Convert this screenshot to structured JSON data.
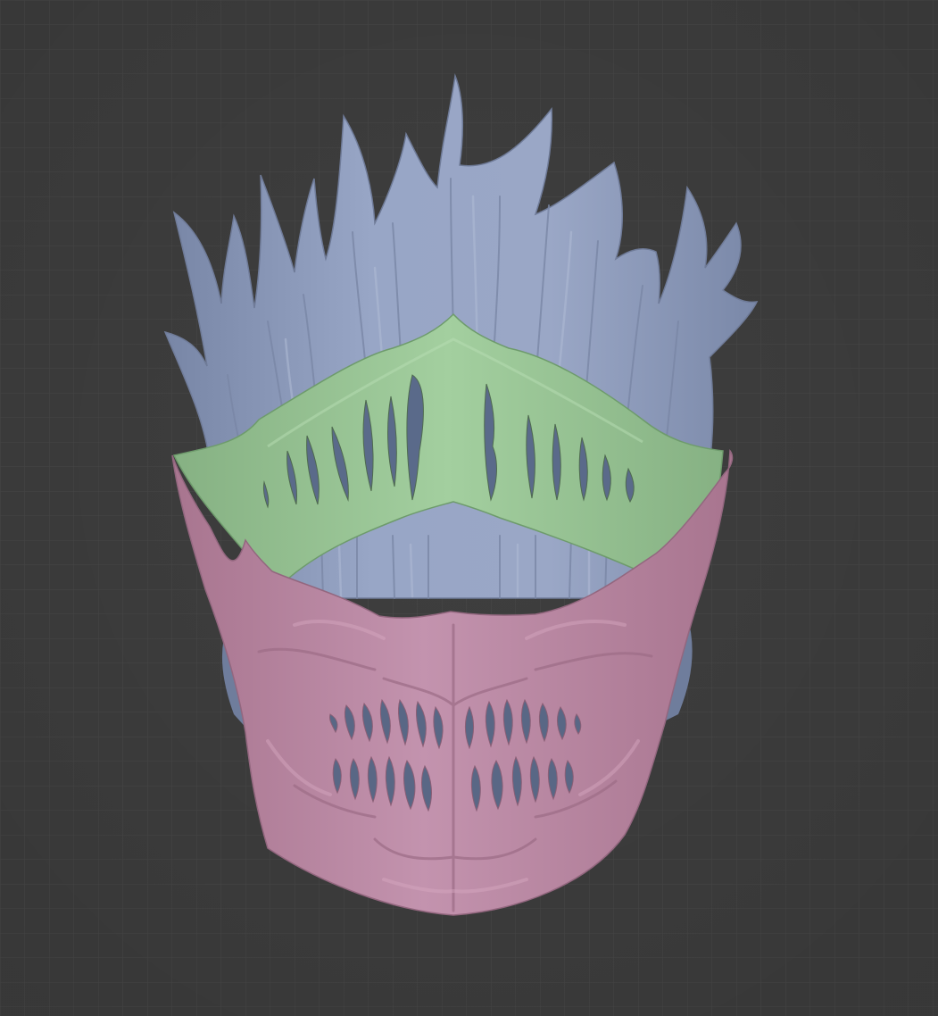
{
  "viewport": {
    "background_color": "#3f3f3f",
    "grid_color": "#4c4c4c",
    "grid_visible": true
  },
  "model": {
    "parts": [
      {
        "part": "flame-crown",
        "color": "#8e9cbd"
      },
      {
        "part": "upper-mask-band",
        "color": "#97c293"
      },
      {
        "part": "lower-jaw-mask",
        "color": "#bd8aa6"
      },
      {
        "part": "inner-shell",
        "color": "#6f7d9c"
      }
    ]
  }
}
